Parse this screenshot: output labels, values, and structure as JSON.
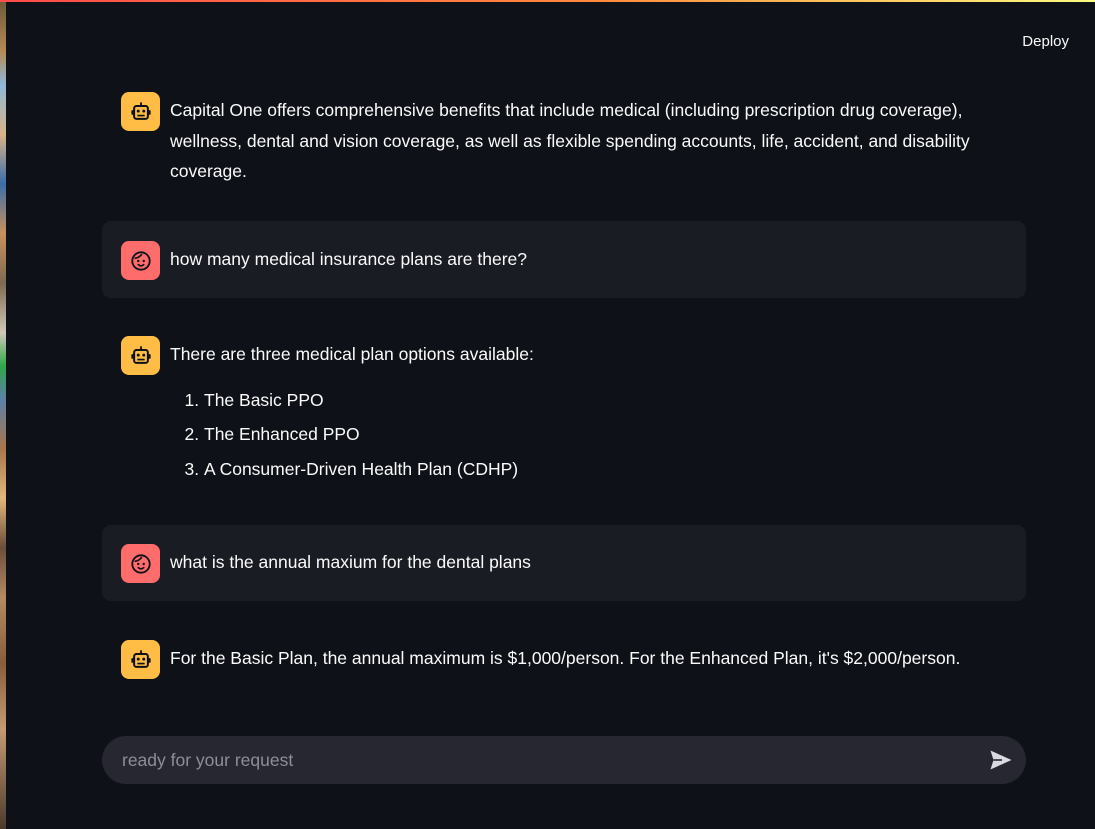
{
  "header": {
    "deploy_label": "Deploy"
  },
  "colors": {
    "background": "#0e1117",
    "user_bubble": "#1a1c24",
    "bot_avatar": "#ffbd45",
    "user_avatar": "#ff6c6c",
    "input_bg": "#262730",
    "text": "#fafafa"
  },
  "messages": [
    {
      "role": "assistant",
      "avatar_icon": "robot-icon",
      "text": "Capital One offers comprehensive benefits that include medical (including prescription drug coverage), wellness, dental and vision coverage, as well as flexible spending accounts, life, accident, and disability coverage."
    },
    {
      "role": "user",
      "avatar_icon": "face-icon",
      "text": "how many medical insurance plans are there?"
    },
    {
      "role": "assistant",
      "avatar_icon": "robot-icon",
      "text": "There are three medical plan options available:",
      "list": [
        "The Basic PPO",
        "The Enhanced PPO",
        "A Consumer-Driven Health Plan (CDHP)"
      ]
    },
    {
      "role": "user",
      "avatar_icon": "face-icon",
      "text": "what is the annual maxium for the dental plans"
    },
    {
      "role": "assistant",
      "avatar_icon": "robot-icon",
      "text": "For the Basic Plan, the annual maximum is $1,000/person. For the Enhanced Plan, it's $2,000/person."
    }
  ],
  "chat_input": {
    "placeholder": "ready for your request",
    "value": "",
    "send_icon": "send-icon"
  }
}
